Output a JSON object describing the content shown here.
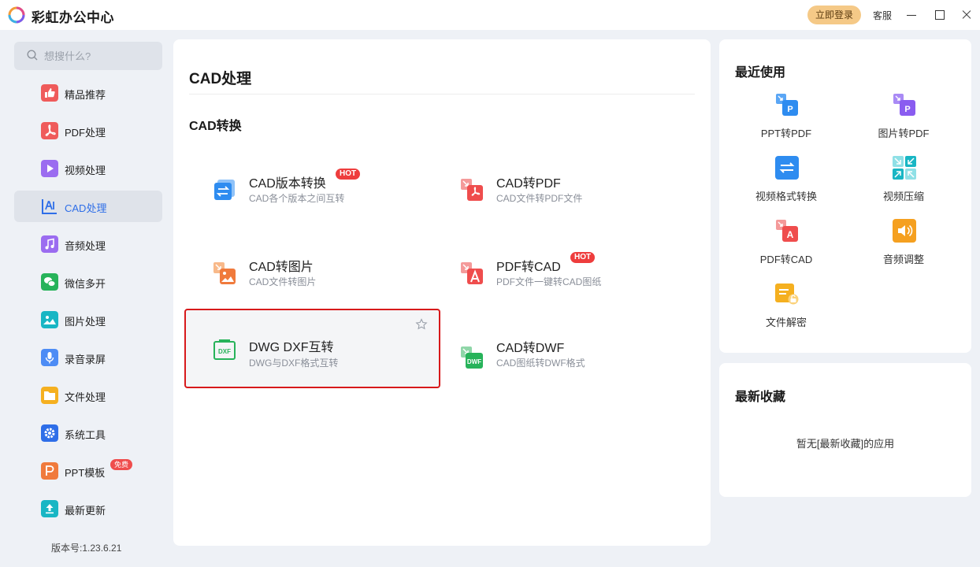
{
  "app": {
    "title": "彩虹办公中心",
    "login_label": "立即登录",
    "service_label": "客服"
  },
  "search": {
    "placeholder": "想搜什么?"
  },
  "sidebar": {
    "items": [
      {
        "label": "精品推荐",
        "icon": "thumbs-up-icon",
        "color": "#ef5b5b",
        "active": false
      },
      {
        "label": "PDF处理",
        "icon": "pdf-icon",
        "color": "#ef5b5b",
        "active": false
      },
      {
        "label": "视频处理",
        "icon": "play-icon",
        "color": "#9b6cf0",
        "active": false
      },
      {
        "label": "CAD处理",
        "icon": "cad-icon",
        "color": "#2e6ee8",
        "active": true
      },
      {
        "label": "音频处理",
        "icon": "music-icon",
        "color": "#9b6cf0",
        "active": false
      },
      {
        "label": "微信多开",
        "icon": "wechat-icon",
        "color": "#27b35a",
        "active": false
      },
      {
        "label": "图片处理",
        "icon": "image-icon",
        "color": "#19b6c4",
        "active": false
      },
      {
        "label": "录音录屏",
        "icon": "microphone-icon",
        "color": "#4d8cf5",
        "active": false
      },
      {
        "label": "文件处理",
        "icon": "folder-icon",
        "color": "#f5b020",
        "active": false
      },
      {
        "label": "系统工具",
        "icon": "gear-icon",
        "color": "#2e6ee8",
        "active": false
      },
      {
        "label": "PPT模板",
        "icon": "ppt-icon",
        "color": "#f07a3c",
        "active": false,
        "badge": "免费"
      },
      {
        "label": "最新更新",
        "icon": "upload-icon",
        "color": "#19b6c4",
        "active": false
      }
    ],
    "version": "版本号:1.23.6.21"
  },
  "main": {
    "title": "CAD处理",
    "section_title": "CAD转换",
    "tools": [
      {
        "name": "CAD版本转换",
        "desc": "CAD各个版本之间互转",
        "badge": "HOT",
        "icon": "cad-version-convert-icon"
      },
      {
        "name": "CAD转PDF",
        "desc": "CAD文件转PDF文件",
        "icon": "cad-to-pdf-icon"
      },
      {
        "name": "CAD转图片",
        "desc": "CAD文件转图片",
        "icon": "cad-to-image-icon"
      },
      {
        "name": "PDF转CAD",
        "desc": "PDF文件一键转CAD图纸",
        "badge": "HOT",
        "icon": "pdf-to-cad-icon"
      },
      {
        "name": "DWG DXF互转",
        "desc": "DWG与DXF格式互转",
        "icon": "dwg-dxf-icon",
        "dxf_text": "DXF"
      },
      {
        "name": "CAD转DWF",
        "desc": "CAD图纸转DWF格式",
        "icon": "cad-to-dwf-icon",
        "dwf_text": "DWF"
      }
    ]
  },
  "recent": {
    "title": "最近使用",
    "items": [
      {
        "label": "PPT转PDF",
        "icon": "ppt-to-pdf-icon",
        "letter": "P"
      },
      {
        "label": "图片转PDF",
        "icon": "image-to-pdf-icon",
        "letter": "P"
      },
      {
        "label": "视频格式转换",
        "icon": "video-convert-icon"
      },
      {
        "label": "视频压缩",
        "icon": "video-compress-icon"
      },
      {
        "label": "PDF转CAD",
        "icon": "pdf-to-cad-icon",
        "letter": "A"
      },
      {
        "label": "音频调整",
        "icon": "audio-adjust-icon"
      },
      {
        "label": "文件解密",
        "icon": "file-decrypt-icon"
      }
    ]
  },
  "favorites": {
    "title": "最新收藏",
    "empty_text": "暂无[最新收藏]的应用"
  }
}
